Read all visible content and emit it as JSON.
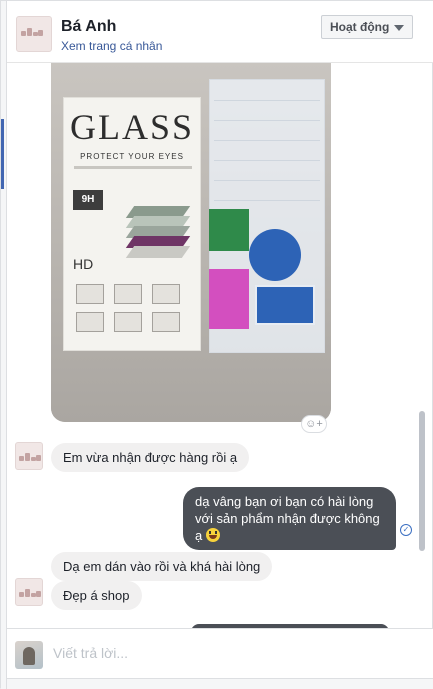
{
  "header": {
    "name": "Bá Anh",
    "profile_link": "Xem trang cá nhân",
    "status_button": "Hoạt động",
    "avatar_icon": "user-avatar-icon"
  },
  "thread": {
    "photo": {
      "kind": "product-photo",
      "box_brand": "GLASS",
      "box_tagline": "PROTECT YOUR EYES",
      "box_badge": "9H",
      "box_label": "HD",
      "react_icon": "add-reaction-icon"
    },
    "messages": [
      {
        "from": "customer",
        "text": "Em vừa nhận được hàng rồi ạ"
      },
      {
        "from": "page",
        "text": "dạ vâng bạn ơi bạn có hài lòng với sản phẩm nhận được không ạ",
        "emoji": "smile-emoji-icon"
      },
      {
        "from": "customer",
        "text": "Dạ em dán vào rồi và khá hài lòng"
      },
      {
        "from": "customer",
        "text": "Đẹp á shop"
      }
    ],
    "seen_icon": "seen-check-icon"
  },
  "composer": {
    "placeholder": "Viết trả lời...",
    "value": ""
  },
  "colors": {
    "link": "#385898",
    "own_bubble": "#4b4f56",
    "other_bubble": "#f1f0f0",
    "accent": "#4267b2"
  }
}
